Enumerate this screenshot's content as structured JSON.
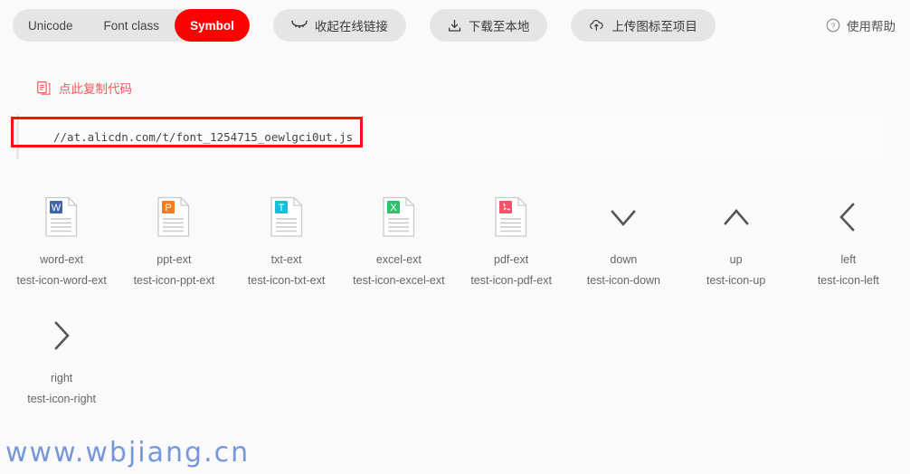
{
  "toolbar": {
    "segments": [
      {
        "label": "Unicode",
        "active": false
      },
      {
        "label": "Font class",
        "active": false
      },
      {
        "label": "Symbol",
        "active": true
      }
    ],
    "buttons": [
      {
        "label": "收起在线链接",
        "icon": "eye-closed-icon"
      },
      {
        "label": "下载至本地",
        "icon": "download-icon"
      },
      {
        "label": "上传图标至项目",
        "icon": "upload-cloud-icon"
      }
    ],
    "help": {
      "label": "使用帮助",
      "icon": "question-circle-icon"
    },
    "active_color": "#ff0000"
  },
  "copy": {
    "label": "点此复制代码",
    "icon": "copy-code-icon",
    "color": "#f05b5b"
  },
  "code": {
    "value": "//at.alicdn.com/t/font_1254715_oewlgci0ut.js",
    "annotation_color": "#ff1010"
  },
  "icons": [
    {
      "name": "word-ext",
      "class": "test-icon-word-ext",
      "glyph": "file-word-icon",
      "badge": "W",
      "badge_color": "#3f64ad"
    },
    {
      "name": "ppt-ext",
      "class": "test-icon-ppt-ext",
      "glyph": "file-ppt-icon",
      "badge": "P",
      "badge_color": "#f57c1f"
    },
    {
      "name": "txt-ext",
      "class": "test-icon-txt-ext",
      "glyph": "file-txt-icon",
      "badge": "T",
      "badge_color": "#18bede"
    },
    {
      "name": "excel-ext",
      "class": "test-icon-excel-ext",
      "glyph": "file-excel-icon",
      "badge": "X",
      "badge_color": "#2ec36a"
    },
    {
      "name": "pdf-ext",
      "class": "test-icon-pdf-ext",
      "glyph": "file-pdf-icon",
      "badge": "A",
      "badge_color": "#f4526a"
    },
    {
      "name": "down",
      "class": "test-icon-down",
      "glyph": "chevron-down-icon",
      "badge": "",
      "badge_color": ""
    },
    {
      "name": "up",
      "class": "test-icon-up",
      "glyph": "chevron-up-icon",
      "badge": "",
      "badge_color": ""
    },
    {
      "name": "left",
      "class": "test-icon-left",
      "glyph": "chevron-left-icon",
      "badge": "",
      "badge_color": ""
    },
    {
      "name": "right",
      "class": "test-icon-right",
      "glyph": "chevron-right-icon",
      "badge": "",
      "badge_color": ""
    }
  ],
  "watermark": {
    "text": "www.wbjiang.cn",
    "color": "#6c8fd8"
  }
}
